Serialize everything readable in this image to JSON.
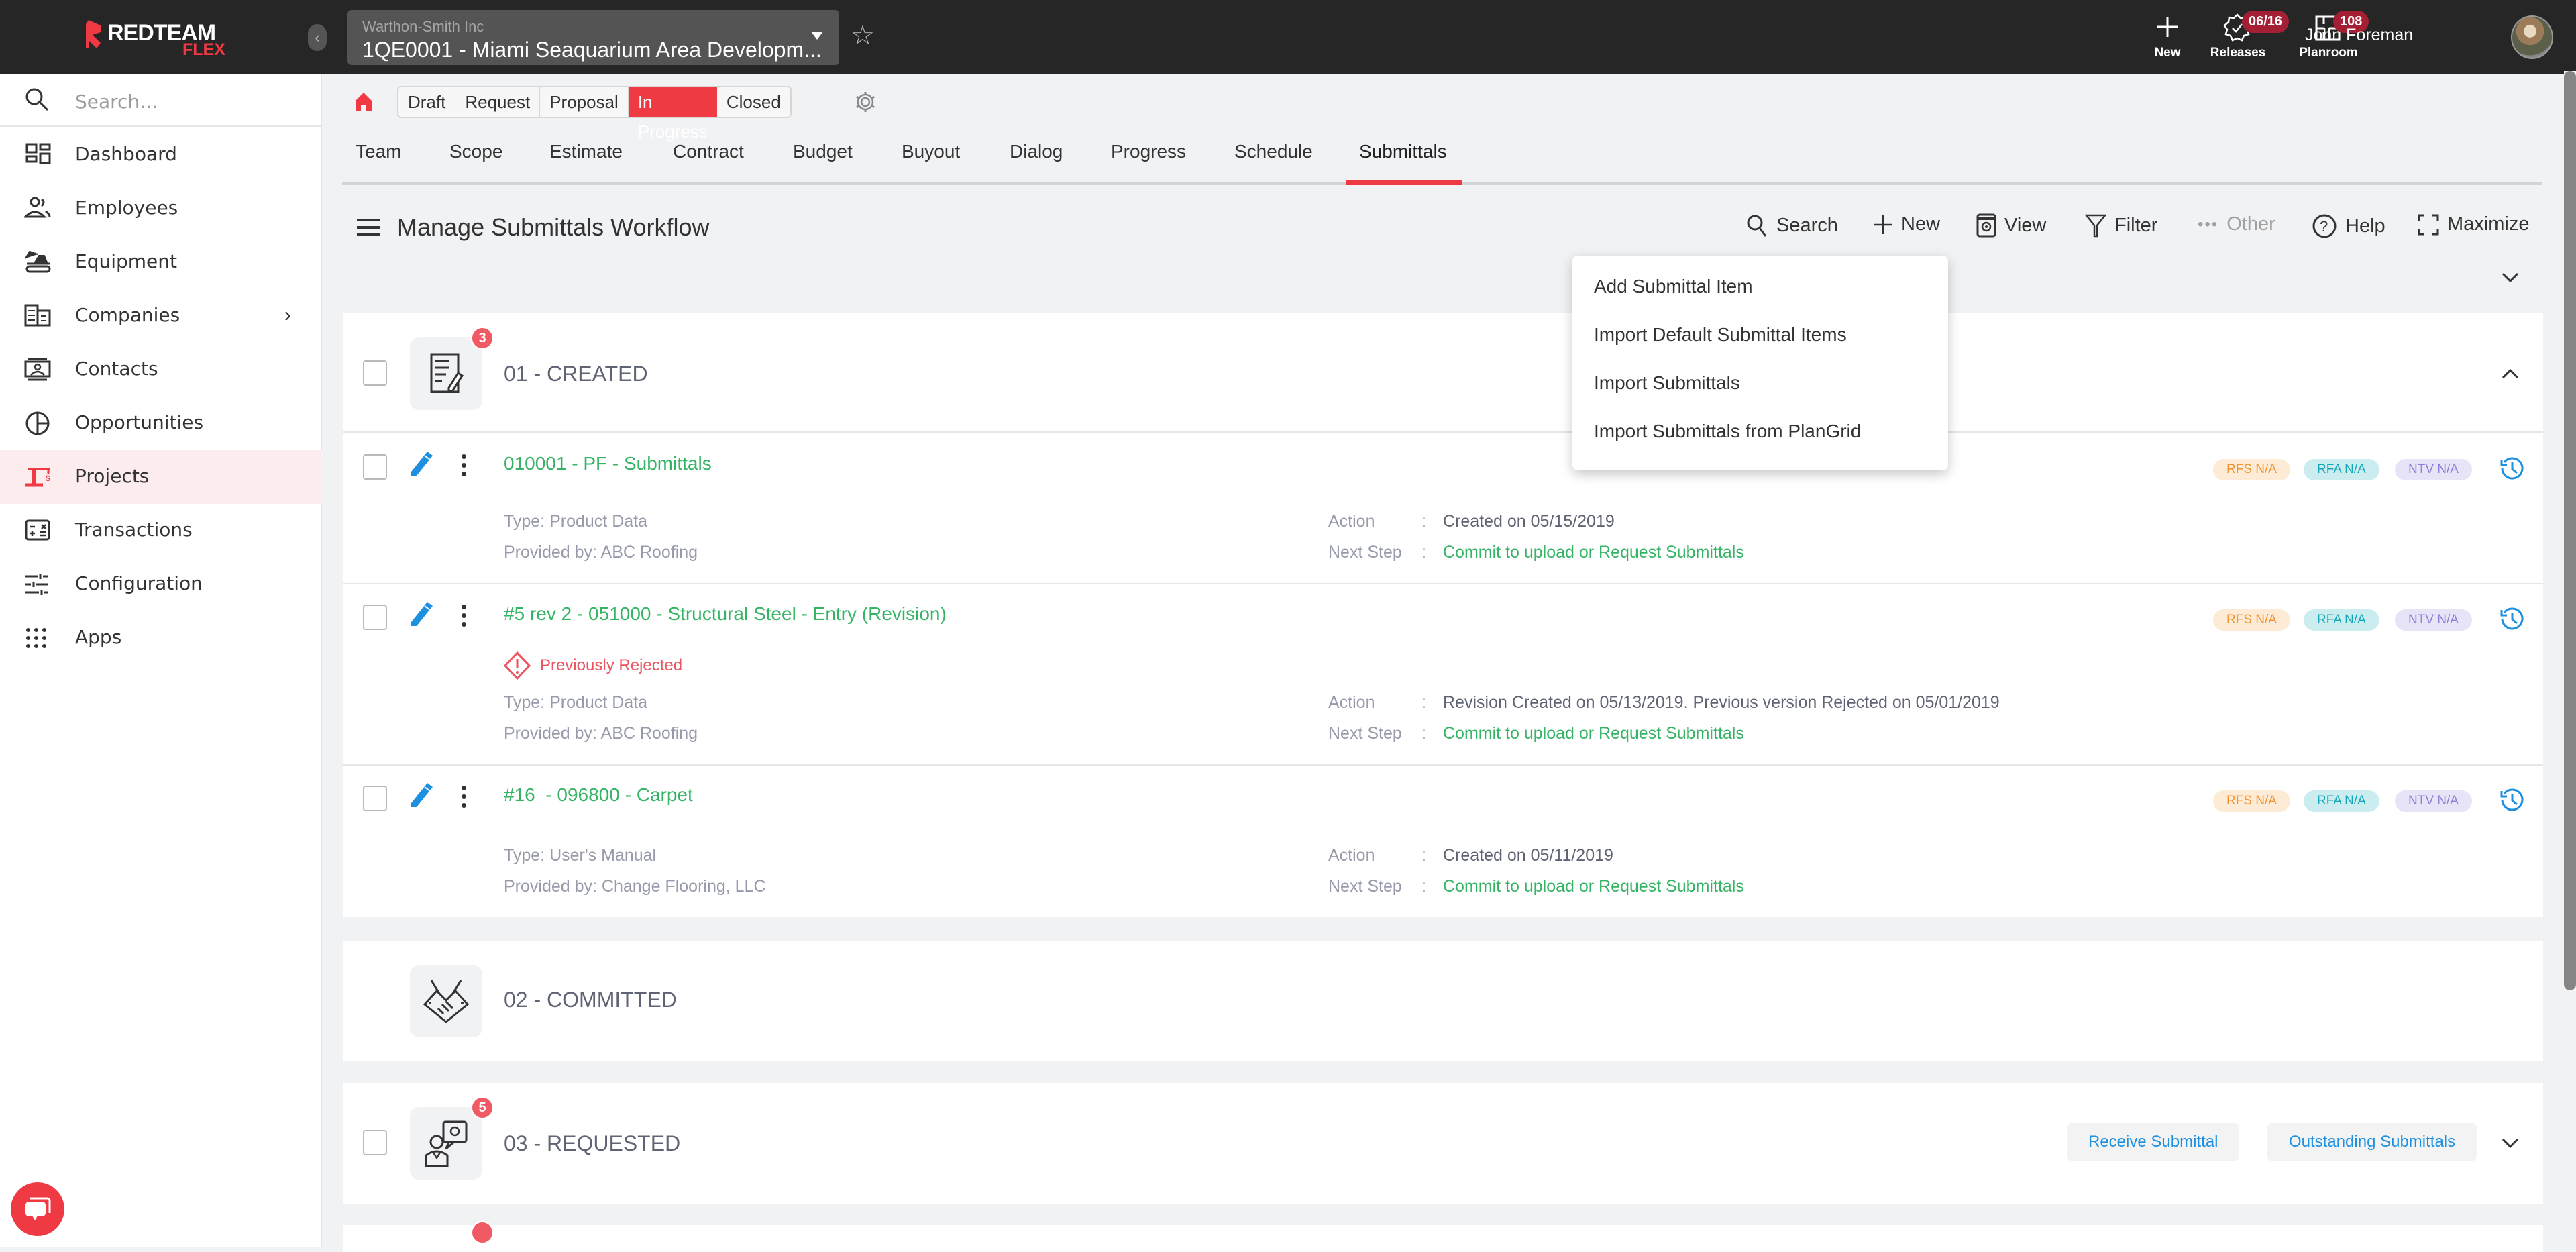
{
  "app": {
    "logo_word": "REDTEAM",
    "logo_sub": "FLEX",
    "company": "Warthon-Smith Inc",
    "project": "1QE0001 - Miami Seaquarium Area Developm...",
    "user_name": "John Foreman"
  },
  "topbar": {
    "new_label": "New",
    "releases_label": "Releases",
    "releases_badge": "06/16",
    "planroom_label": "Planroom",
    "planroom_badge": "108"
  },
  "sidebar": {
    "search_placeholder": "Search...",
    "items": [
      {
        "label": "Dashboard",
        "icon": "dashboard-icon"
      },
      {
        "label": "Employees",
        "icon": "employees-icon"
      },
      {
        "label": "Equipment",
        "icon": "excavator-icon"
      },
      {
        "label": "Companies",
        "icon": "companies-icon",
        "has_submenu": true
      },
      {
        "label": "Contacts",
        "icon": "contact-card-icon"
      },
      {
        "label": "Opportunities",
        "icon": "pie-icon"
      },
      {
        "label": "Projects",
        "icon": "crane-icon",
        "active": true
      },
      {
        "label": "Transactions",
        "icon": "calculator-icon"
      },
      {
        "label": "Configuration",
        "icon": "sliders-icon"
      },
      {
        "label": "Apps",
        "icon": "apps-grid-icon"
      }
    ]
  },
  "status_steps": [
    {
      "label": "Draft"
    },
    {
      "label": "Request"
    },
    {
      "label": "Proposal"
    },
    {
      "label": "In Progress",
      "current": true
    },
    {
      "label": "Closed"
    }
  ],
  "tabs": [
    "Team",
    "Scope",
    "Estimate",
    "Contract",
    "Budget",
    "Buyout",
    "Dialog",
    "Progress",
    "Schedule",
    "Submittals"
  ],
  "active_tab": "Submittals",
  "panel": {
    "title": "Manage Submittals Workflow",
    "toolbar": {
      "search": "Search",
      "new": "New",
      "view": "View",
      "filter": "Filter",
      "other": "Other",
      "help": "Help",
      "maximize": "Maximize"
    }
  },
  "new_menu": {
    "items": [
      "Add Submittal Item",
      "Import Default Submittal Items",
      "Import Submittals",
      "Import Submittals from PlanGrid"
    ]
  },
  "labels": {
    "action": "Action",
    "next_step": "Next Step",
    "colon": ":"
  },
  "stages": [
    {
      "title": "01 - CREATED",
      "badge": "3",
      "expanded": true,
      "items": [
        {
          "title": "010001 - PF - Submittals",
          "type": "Type: Product Data",
          "provider": "Provided by: ABC Roofing",
          "action": "Created on 05/15/2019",
          "next_step": "Commit to upload or Request Submittals",
          "rfs": "RFS N/A",
          "rfa": "RFA N/A",
          "ntv": "NTV N/A"
        },
        {
          "title": "#5 rev 2 - 051000 - Structural Steel - Entry (Revision)",
          "warning": "Previously Rejected",
          "type": "Type: Product Data",
          "provider": "Provided by: ABC Roofing",
          "action": "Revision Created on 05/13/2019. Previous version Rejected on 05/01/2019",
          "next_step": "Commit to upload or Request Submittals",
          "rfs": "RFS N/A",
          "rfa": "RFA N/A",
          "ntv": "NTV N/A"
        },
        {
          "title": "#16  - 096800 - Carpet",
          "type": "Type: User's Manual",
          "provider": "Provided by: Change Flooring, LLC",
          "action": "Created on 05/11/2019",
          "next_step": "Commit to upload or Request Submittals",
          "rfs": "RFS N/A",
          "rfa": "RFA N/A",
          "ntv": "NTV N/A"
        }
      ]
    },
    {
      "title": "02 - COMMITTED"
    },
    {
      "title": "03 - REQUESTED",
      "badge": "5",
      "buttons": [
        "Receive Submittal",
        "Outstanding Submittals"
      ]
    }
  ],
  "colors": {
    "brand_red": "#ef3a44",
    "link_green": "#35b465",
    "action_blue": "#1e90e0",
    "warning_red": "#ea5560"
  }
}
